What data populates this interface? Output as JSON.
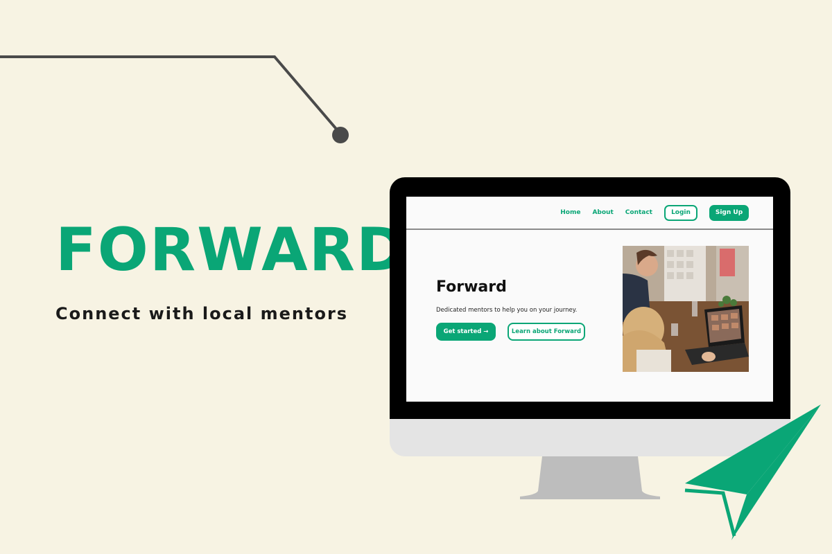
{
  "brand": {
    "title": "FORWARD",
    "tagline": "Connect with local mentors",
    "accent_color": "#0aa676",
    "background_color": "#f7f3e3"
  },
  "website": {
    "nav": {
      "links": [
        "Home",
        "About",
        "Contact"
      ],
      "login_label": "Login",
      "signup_label": "Sign Up"
    },
    "hero": {
      "title": "Forward",
      "subtitle": "Dedicated mentors to help you on your journey.",
      "primary_button": "Get started →",
      "secondary_button": "Learn about Forward"
    },
    "photo_description_icon": "mentoring-photo"
  },
  "decorations": {
    "line_icon": "connector-line",
    "arrow_icon": "paper-plane-arrow-icon"
  }
}
